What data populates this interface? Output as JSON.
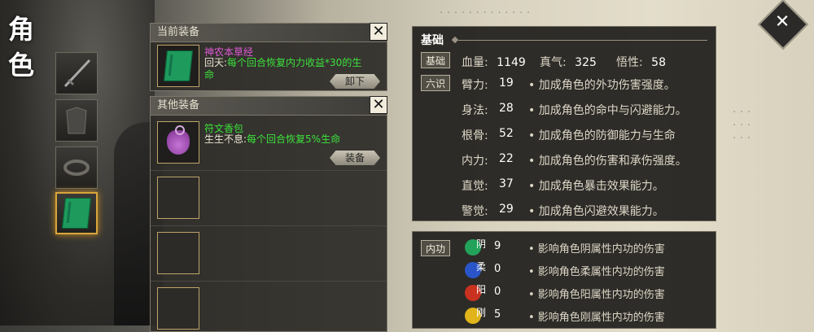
{
  "sidebar": {
    "title": "角色",
    "slots": [
      {
        "icon": "sword-icon",
        "active": false
      },
      {
        "icon": "robe-icon",
        "active": false
      },
      {
        "icon": "belt-icon",
        "active": false
      },
      {
        "icon": "green-book-icon",
        "active": true
      }
    ]
  },
  "current_equipment": {
    "header": "当前装备",
    "item": {
      "name": "神农本草经",
      "name_color": "#e05ad8",
      "effect_name": "回天:",
      "effect_text": "每个回合恢复内力收益*30的生命"
    },
    "unequip_label": "卸下"
  },
  "other_equipment": {
    "header": "其他装备",
    "item": {
      "name": "符文香包",
      "name_color": "#3be23b",
      "effect_name": "生生不息:",
      "effect_text": "每个回合恢复5%生命"
    },
    "equip_label": "装备"
  },
  "stats": {
    "section_title": "基础",
    "basic_tag": "基础",
    "six_tag": "六识",
    "hp_label": "血量:",
    "hp_value": "1149",
    "qi_label": "真气:",
    "qi_value": "325",
    "wuxing_label": "悟性:",
    "wuxing_value": "58",
    "attributes": [
      {
        "label": "臂力:",
        "value": "19",
        "desc": "• 加成角色的外功伤害强度。"
      },
      {
        "label": "身法:",
        "value": "28",
        "desc": "• 加成角色的命中与闪避能力。"
      },
      {
        "label": "根骨:",
        "value": "52",
        "desc": "• 加成角色的防御能力与生命"
      },
      {
        "label": "内力:",
        "value": "22",
        "desc": "• 加成角色的伤害和承伤强度。"
      },
      {
        "label": "直觉:",
        "value": "37",
        "desc": "• 加成角色暴击效果能力。"
      },
      {
        "label": "警觉:",
        "value": "29",
        "desc": "• 加成角色闪避效果能力。"
      }
    ]
  },
  "neigong": {
    "tag": "内功",
    "rows": [
      {
        "label": "阴",
        "value": "9",
        "color": "#22a25a",
        "desc": "• 影响角色阴属性内功的伤害"
      },
      {
        "label": "柔",
        "value": "0",
        "color": "#2a55c8",
        "desc": "• 影响角色柔属性内功的伤害"
      },
      {
        "label": "阳",
        "value": "0",
        "color": "#c8321f",
        "desc": "• 影响角色阳属性内功的伤害"
      },
      {
        "label": "刚",
        "value": "5",
        "color": "#e0b41a",
        "desc": "• 影响角色刚属性内功的伤害"
      }
    ]
  },
  "close_button": "✕",
  "corner_button": "✕"
}
